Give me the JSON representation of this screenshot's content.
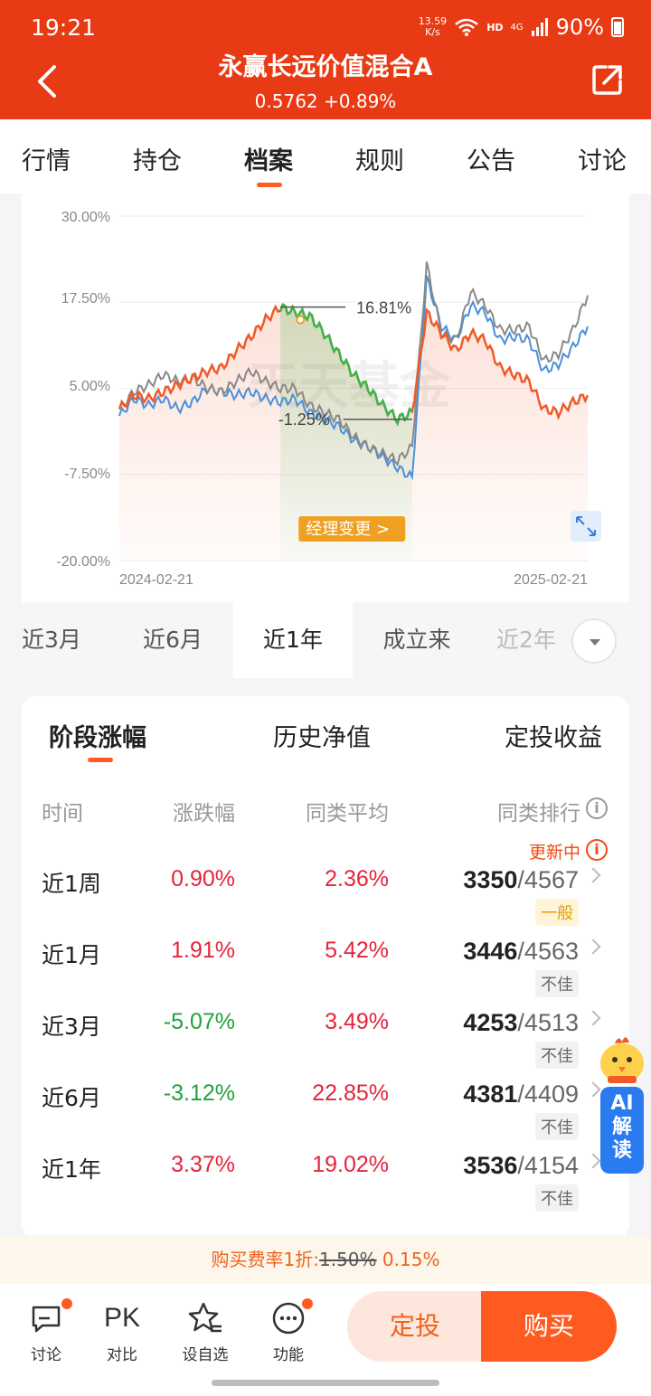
{
  "status_bar": {
    "time": "19:21",
    "net_speed_value": "13.59",
    "net_speed_unit": "K/s",
    "hd": "HD",
    "network": "4G",
    "battery": "90%"
  },
  "header": {
    "title": "永赢长远价值混合A",
    "nav_value": "0.5762",
    "nav_change": "+0.89%"
  },
  "tabs": [
    "行情",
    "持仓",
    "档案",
    "规则",
    "公告",
    "讨论"
  ],
  "active_tab": "档案",
  "chart": {
    "y_ticks": [
      "30.00%",
      "17.50%",
      "5.00%",
      "-7.50%",
      "-20.00%"
    ],
    "x_start": "2024-02-21",
    "x_end": "2025-02-21",
    "high_label": "16.81%",
    "low_label": "-1.25%",
    "manager_change_label": "经理变更 >",
    "watermark": "天天基金",
    "colors": {
      "fund": "#f05a28",
      "peer": "#888888",
      "index": "#4a90d9",
      "manager_period": "#3cb54a",
      "marker": "#f0a020"
    }
  },
  "chart_data": {
    "type": "line",
    "x_range": [
      "2024-02-21",
      "2025-02-21"
    ],
    "ylim": [
      -20,
      30
    ],
    "y_unit": "%",
    "series": [
      {
        "color": "#f05a28",
        "values": [
          2.0,
          4.0,
          3.5,
          4.5,
          5.5,
          6.5,
          7.5,
          8.0,
          10.5,
          12.5,
          15.0,
          16.8,
          16.0,
          15.5,
          13.0,
          10.0,
          7.0,
          5.0,
          2.5,
          0.5,
          1.5,
          16.0,
          13.0,
          10.5,
          13.0,
          12.0,
          8.0,
          7.0,
          6.0,
          2.0,
          1.5,
          3.0,
          4.0
        ]
      },
      {
        "color": "#888888",
        "values": [
          2.0,
          4.5,
          5.5,
          7.0,
          6.0,
          6.5,
          5.0,
          4.5,
          6.0,
          7.5,
          6.0,
          5.0,
          5.0,
          2.5,
          1.5,
          0.5,
          -2.0,
          -3.5,
          -4.5,
          -5.5,
          -3.5,
          23.0,
          13.0,
          12.0,
          19.0,
          17.0,
          13.5,
          13.5,
          14.0,
          9.0,
          10.0,
          13.5,
          18.5
        ]
      },
      {
        "color": "#4a90d9",
        "values": [
          1.0,
          3.5,
          2.5,
          3.5,
          2.0,
          3.0,
          5.0,
          4.5,
          4.0,
          4.5,
          3.5,
          3.0,
          3.5,
          1.5,
          0.5,
          -0.5,
          -2.5,
          -3.5,
          -5.0,
          -6.5,
          -8.0,
          21.0,
          14.0,
          12.0,
          17.0,
          16.0,
          12.0,
          12.5,
          12.0,
          7.5,
          8.5,
          11.0,
          14.0
        ]
      }
    ]
  },
  "ranges": [
    "近3月",
    "近6月",
    "近1年",
    "成立来",
    "近2年"
  ],
  "active_range": "近1年",
  "returns": {
    "sub_tabs": [
      "阶段涨幅",
      "历史净值",
      "定投收益"
    ],
    "active_sub_tab": "阶段涨幅",
    "headers": [
      "时间",
      "涨跌幅",
      "同类平均",
      "同类排行"
    ],
    "updating_label": "更新中",
    "rows": [
      {
        "period": "近1周",
        "change": "0.90%",
        "avg": "2.36%",
        "rank": "3350",
        "total": "/4567",
        "level": "一般"
      },
      {
        "period": "近1月",
        "change": "1.91%",
        "avg": "5.42%",
        "rank": "3446",
        "total": "/4563",
        "level": "不佳"
      },
      {
        "period": "近3月",
        "change": "-5.07%",
        "avg": "3.49%",
        "rank": "4253",
        "total": "/4513",
        "level": "不佳"
      },
      {
        "period": "近6月",
        "change": "-3.12%",
        "avg": "22.85%",
        "rank": "4381",
        "total": "/4409",
        "level": "不佳"
      },
      {
        "period": "近1年",
        "change": "3.37%",
        "avg": "19.02%",
        "rank": "3536",
        "total": "/4154",
        "level": "不佳"
      }
    ]
  },
  "fee": {
    "prefix": "购买费率1折:",
    "old": "1.50%",
    "new": "0.15%"
  },
  "ai_float": {
    "line1": "AI",
    "line2": "解",
    "line3": "读"
  },
  "bottom_bar": {
    "discuss": "讨论",
    "pk_icon_text": "PK",
    "pk": "对比",
    "watchlist": "设自选",
    "functions": "功能",
    "dingtou": "定投",
    "buy": "购买"
  }
}
